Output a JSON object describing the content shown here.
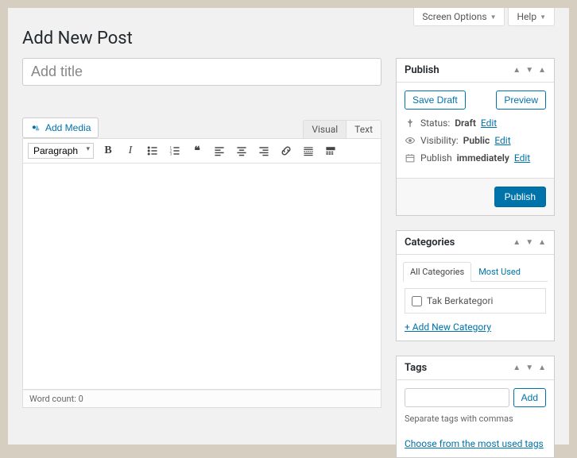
{
  "header": {
    "screen_options": "Screen Options",
    "help": "Help",
    "page_title": "Add New Post"
  },
  "title_placeholder": "Add title",
  "media_button": "Add Media",
  "editor_tabs": {
    "visual": "Visual",
    "text": "Text"
  },
  "format_select": "Paragraph",
  "word_count_label": "Word count: 0",
  "publish_box": {
    "title": "Publish",
    "save_draft": "Save Draft",
    "preview": "Preview",
    "status_label": "Status:",
    "status_value": "Draft",
    "visibility_label": "Visibility:",
    "visibility_value": "Public",
    "schedule_label": "Publish",
    "schedule_value": "immediately",
    "edit": "Edit",
    "publish_btn": "Publish"
  },
  "categories_box": {
    "title": "Categories",
    "tab_all": "All Categories",
    "tab_most": "Most Used",
    "items": [
      "Tak Berkategori"
    ],
    "add_new": "+ Add New Category"
  },
  "tags_box": {
    "title": "Tags",
    "add_btn": "Add",
    "hint": "Separate tags with commas",
    "choose_link": "Choose from the most used tags"
  }
}
